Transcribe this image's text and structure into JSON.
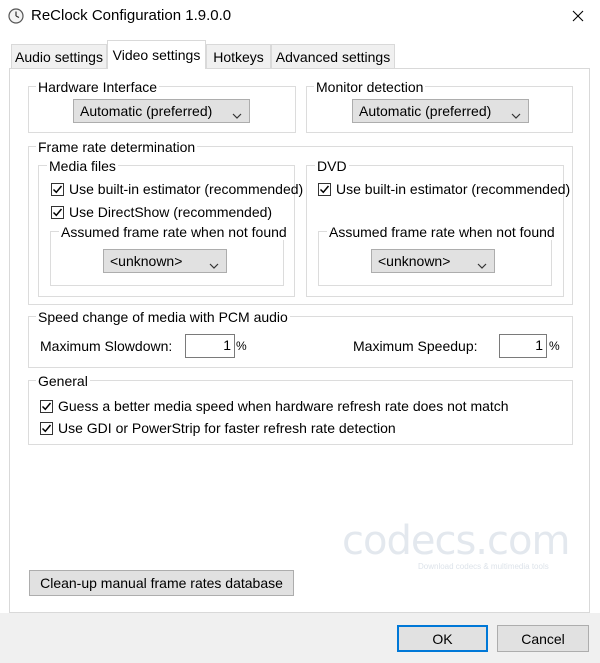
{
  "window": {
    "title": "ReClock Configuration 1.9.0.0",
    "icon": "clock-icon",
    "close_icon": "close-icon"
  },
  "tabs": [
    {
      "label": "Audio settings",
      "active": false
    },
    {
      "label": "Video settings",
      "active": true
    },
    {
      "label": "Hotkeys",
      "active": false
    },
    {
      "label": "Advanced settings",
      "active": false
    }
  ],
  "hardware_interface": {
    "legend": "Hardware Interface",
    "selected": "Automatic (preferred)"
  },
  "monitor_detection": {
    "legend": "Monitor detection",
    "selected": "Automatic (preferred)"
  },
  "frame_rate": {
    "legend": "Frame rate determination",
    "media_files": {
      "legend": "Media files",
      "builtin_label": "Use built-in estimator (recommended)",
      "builtin_checked": true,
      "directshow_label": "Use DirectShow (recommended)",
      "directshow_checked": true,
      "assumed_legend": "Assumed frame rate when not found",
      "assumed_selected": "<unknown>"
    },
    "dvd": {
      "legend": "DVD",
      "builtin_label": "Use built-in estimator (recommended)",
      "builtin_checked": true,
      "assumed_legend": "Assumed frame rate when not found",
      "assumed_selected": "<unknown>"
    }
  },
  "speed_change": {
    "legend": "Speed change of media with PCM audio",
    "slowdown_label": "Maximum Slowdown:",
    "slowdown_value": "1",
    "speedup_label": "Maximum Speedup:",
    "speedup_value": "1",
    "unit": "%"
  },
  "general": {
    "legend": "General",
    "guess_label": "Guess a better media speed when hardware refresh rate does not match",
    "guess_checked": true,
    "gdi_label": "Use GDI or PowerStrip for faster refresh rate detection",
    "gdi_checked": true
  },
  "cleanup_button": "Clean-up manual frame rates database",
  "watermark": {
    "text": "codecs.com",
    "subtext": "Download codecs & multimedia tools"
  },
  "buttons": {
    "ok": "OK",
    "cancel": "Cancel"
  },
  "colors": {
    "accent": "#0078d7",
    "control_face": "#e1e1e1",
    "group_border": "#dcdcdc"
  }
}
